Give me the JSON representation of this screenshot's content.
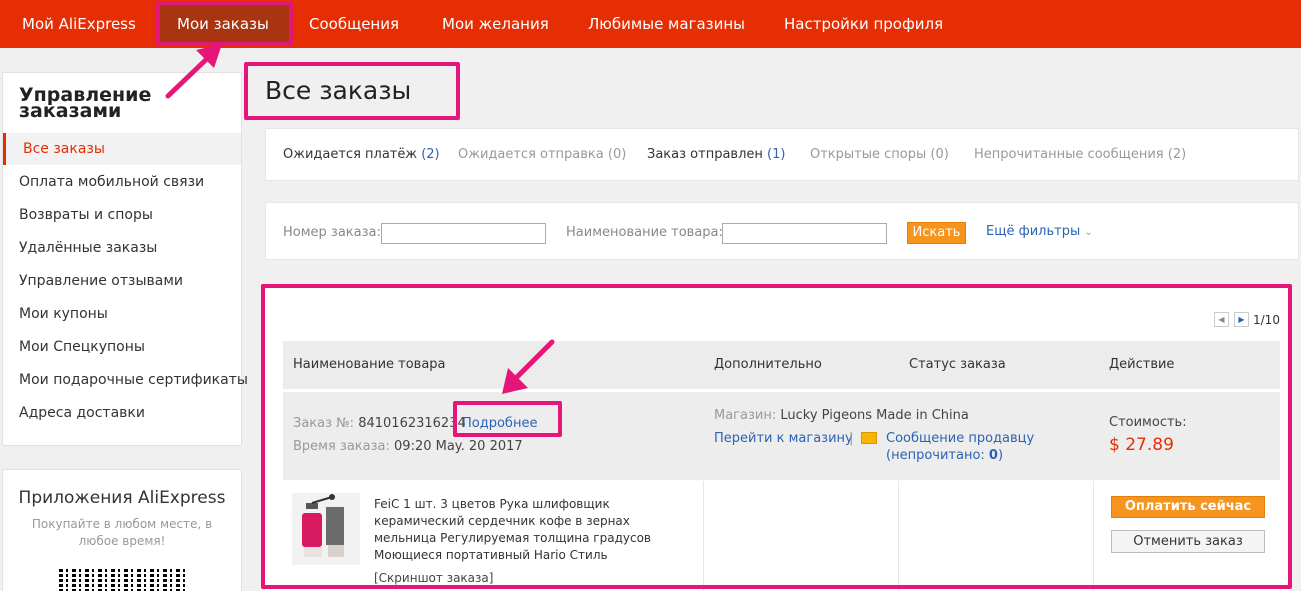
{
  "nav": {
    "items": [
      {
        "label": "Мой AliExpress"
      },
      {
        "label": "Мои заказы"
      },
      {
        "label": "Сообщения"
      },
      {
        "label": "Мои желания"
      },
      {
        "label": "Любимые магазины"
      },
      {
        "label": "Настройки профиля"
      }
    ],
    "active_index": 1
  },
  "sidebar": {
    "title_line1": "Управление",
    "title_line2": "заказами",
    "items": [
      {
        "label": "Все заказы"
      },
      {
        "label": "Оплата мобильной связи"
      },
      {
        "label": "Возвраты и споры"
      },
      {
        "label": "Удалённые заказы"
      },
      {
        "label": "Управление отзывами"
      },
      {
        "label": "Мои купоны"
      },
      {
        "label": "Мои Спецкупоны"
      },
      {
        "label": "Мои подарочные сертификаты"
      },
      {
        "label": "Адреса доставки"
      }
    ],
    "active_index": 0
  },
  "apps": {
    "title": "Приложения AliExpress",
    "subtitle": "Покупайте в любом месте, в любое время!"
  },
  "main": {
    "title": "Все заказы",
    "status_tabs": [
      {
        "label": "Ожидается платёж",
        "count": "(2)"
      },
      {
        "label": "Ожидается отправка",
        "count": "(0)"
      },
      {
        "label": "Заказ отправлен",
        "count": "(1)"
      },
      {
        "label": "Открытые споры",
        "count": "(0)"
      },
      {
        "label": "Непрочитанные сообщения",
        "count": "(2)"
      }
    ],
    "filters": {
      "order_number_label": "Номер заказа:",
      "order_number_value": "",
      "product_name_label": "Наименование товара:",
      "product_name_value": "",
      "search_button": "Искать",
      "more_filters": "Ещё фильтры"
    },
    "pagination": {
      "page": "1/10"
    },
    "table_headers": [
      "Наименование товара",
      "Дополнительно",
      "Статус заказа",
      "Действие"
    ],
    "order": {
      "number_label": "Заказ №:",
      "number": "8410162316234",
      "details_link": "Подробнее",
      "time_label": "Время заказа:",
      "time": "09:20 May. 20 2017",
      "store_label": "Магазин:",
      "store_name": "Lucky Pigeons Made in China",
      "go_to_store": "Перейти к магазину",
      "separator": "|",
      "message_seller": "Сообщение продавцу",
      "unread_label": "(непрочитано:",
      "unread_count": "0",
      "unread_close": ")",
      "cost_label": "Стоимость:",
      "cost": "$ 27.89",
      "product_title": "FeiC 1 шт. 3 цветов Рука шлифовщик керамический сердечник кофе в зернах мельница Регулируемая толщина градусов Моющиеся портативный Hario Стиль",
      "snapshot_link": "[Скриншот заказа]",
      "pay_button": "Оплатить сейчас",
      "cancel_button": "Отменить заказ"
    }
  },
  "colors": {
    "brand_red": "#e62e04",
    "active_nav": "#a83410",
    "highlight_pink": "#e5157a",
    "link_blue": "#2a63b3",
    "orange_button": "#f7941d"
  }
}
